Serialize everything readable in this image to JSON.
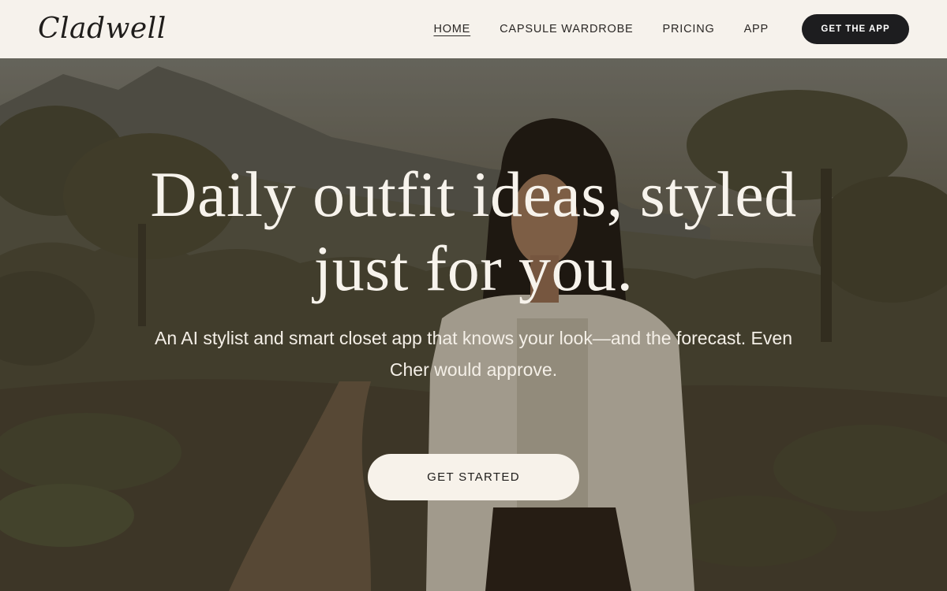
{
  "header": {
    "logo": "Cladwell",
    "nav": [
      {
        "label": "HOME",
        "active": true
      },
      {
        "label": "CAPSULE WARDROBE",
        "active": false
      },
      {
        "label": "PRICING",
        "active": false
      },
      {
        "label": "APP",
        "active": false
      }
    ],
    "cta_label": "GET THE APP"
  },
  "hero": {
    "headline_line1": "Daily outfit ideas, styled",
    "headline_line2": "just for you.",
    "subhead_line1": "An AI stylist and smart closet app that knows your look—and the forecast. Even",
    "subhead_line2": "Cher would approve.",
    "cta_label": "GET STARTED"
  },
  "colors": {
    "header_bg": "#f6f2ec",
    "dark_button": "#1d1d1f",
    "light_button": "#f7f2ea",
    "hero_text": "#f7f3ec"
  }
}
